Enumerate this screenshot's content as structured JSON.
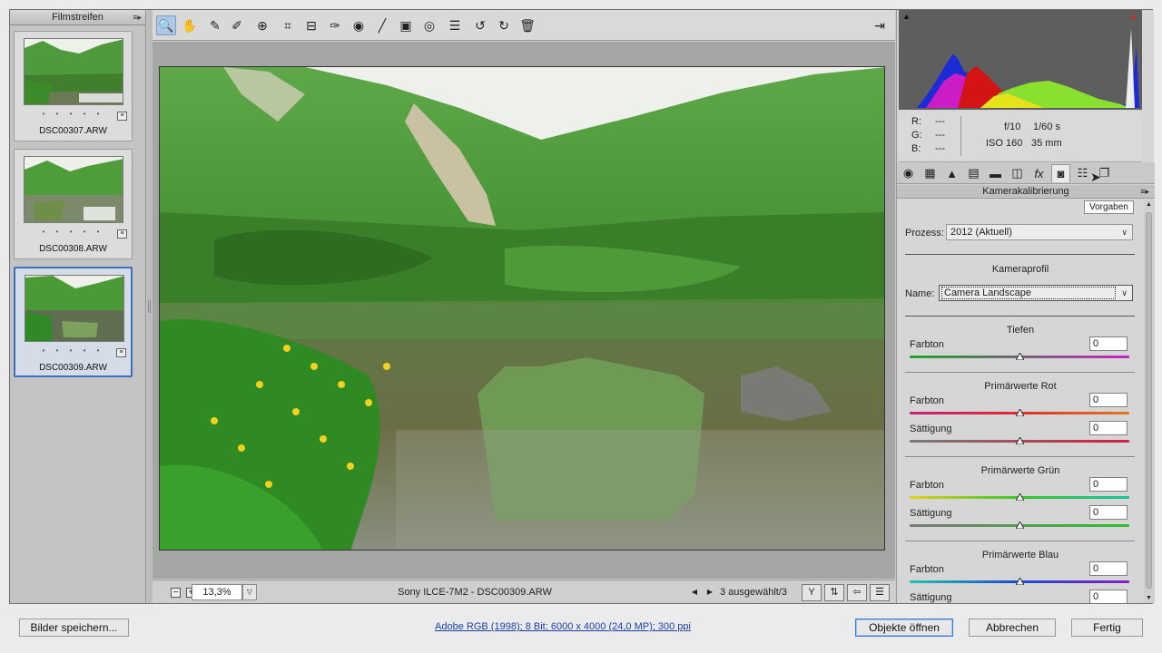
{
  "filmstrip": {
    "title": "Filmstreifen",
    "items": [
      {
        "filename": "DSC00307.ARW",
        "stars": "• • • • •"
      },
      {
        "filename": "DSC00308.ARW",
        "stars": "• • • • •"
      },
      {
        "filename": "DSC00309.ARW",
        "stars": "• • • • •"
      }
    ]
  },
  "toolbar": {
    "tools": [
      "zoom-icon",
      "hand-icon",
      "white-balance-icon",
      "color-sampler-icon",
      "target-adjust-icon",
      "crop-icon",
      "straighten-icon",
      "spot-removal-icon",
      "red-eye-icon",
      "adjustment-brush-icon",
      "graduated-filter-icon",
      "radial-filter-icon",
      "preferences-icon",
      "rotate-left-icon",
      "rotate-right-icon",
      "trash-icon"
    ],
    "active_tool": "zoom-icon"
  },
  "status": {
    "zoom_value": "13,3%",
    "file_label": "Sony ILCE-7M2 - DSC00309.ARW",
    "selection_count": "3 ausgewählt/3"
  },
  "readout": {
    "r_label": "R:",
    "r_value": "---",
    "g_label": "G:",
    "g_value": "---",
    "b_label": "B:",
    "b_value": "---",
    "aperture": "f/10",
    "shutter": "1/60 s",
    "iso": "ISO 160",
    "focal": "35 mm"
  },
  "panel": {
    "title": "Kamerakalibrierung",
    "tooltip": "Vorgaben",
    "process_label": "Prozess:",
    "process_value": "2012 (Aktuell)",
    "profile_section": "Kameraprofil",
    "name_label": "Name:",
    "name_value": "Camera Landscape",
    "sections": [
      {
        "title": "Tiefen",
        "sliders": [
          {
            "label": "Farbton",
            "value": "0"
          }
        ]
      },
      {
        "title": "Primärwerte Rot",
        "sliders": [
          {
            "label": "Farbton",
            "value": "0"
          },
          {
            "label": "Sättigung",
            "value": "0"
          }
        ]
      },
      {
        "title": "Primärwerte Grün",
        "sliders": [
          {
            "label": "Farbton",
            "value": "0"
          },
          {
            "label": "Sättigung",
            "value": "0"
          }
        ]
      },
      {
        "title": "Primärwerte Blau",
        "sliders": [
          {
            "label": "Farbton",
            "value": "0"
          },
          {
            "label": "Sättigung",
            "value": "0"
          }
        ]
      }
    ]
  },
  "bottom": {
    "save_label": "Bilder speichern...",
    "workflow_link": "Adobe RGB (1998); 8 Bit; 6000 x 4000 (24,0 MP); 300 ppi",
    "open_label": "Objekte öffnen",
    "cancel_label": "Abbrechen",
    "done_label": "Fertig"
  }
}
